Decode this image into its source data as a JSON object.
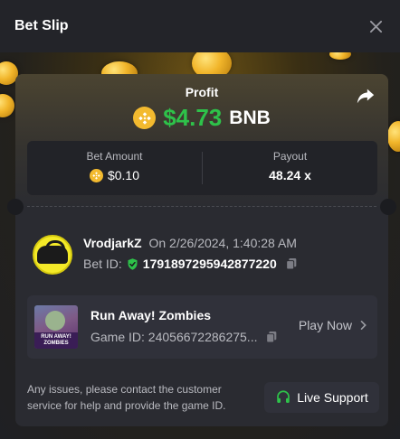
{
  "header": {
    "title": "Bet Slip"
  },
  "profit": {
    "label": "Profit",
    "amount": "$4.73",
    "currency": "BNB"
  },
  "stats": {
    "bet_amount_label": "Bet Amount",
    "bet_amount_value": "$0.10",
    "payout_label": "Payout",
    "payout_value": "48.24 x"
  },
  "user": {
    "username": "VrodjarkZ",
    "timestamp": "On 2/26/2024, 1:40:28 AM",
    "bet_id_label": "Bet ID:",
    "bet_id_value": "1791897295942877220"
  },
  "game": {
    "title": "Run Away! Zombies",
    "game_id_text": "Game ID: 24056672286275...",
    "thumbnail_caption": "RUN AWAY! ZOMBIES",
    "play_label": "Play Now"
  },
  "footer": {
    "notice": "Any issues, please contact the customer service for help and provide the game ID.",
    "support_label": "Live Support"
  },
  "colors": {
    "profit_green": "#2ec24a",
    "bnb_yellow": "#f3ba2f",
    "support_icon_green": "#2ec24a",
    "verified_green": "#2ec24a",
    "panel_bg": "#2a2b31"
  },
  "icons": {
    "close": "close-icon",
    "share": "share-icon",
    "bnb": "bnb-coin-icon",
    "verified": "shield-check-icon",
    "copy": "copy-icon",
    "chevron": "chevron-right-icon",
    "headset": "headset-icon"
  }
}
